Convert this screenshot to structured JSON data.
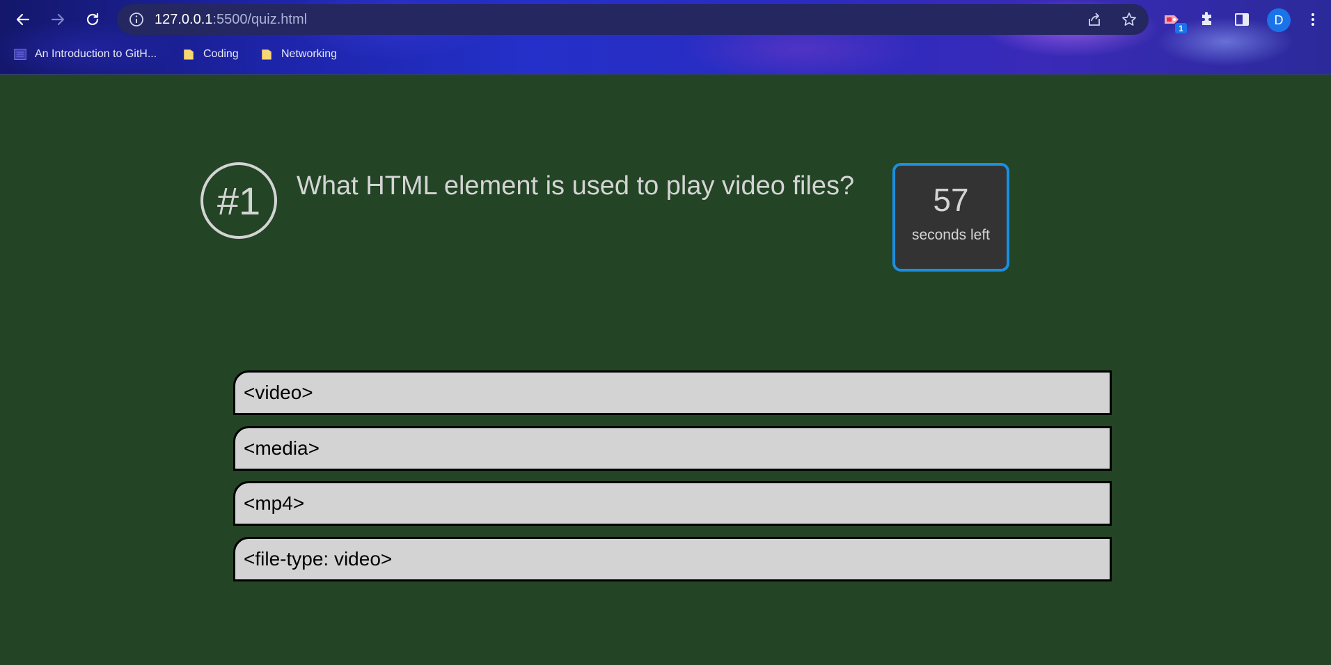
{
  "browser": {
    "url_host": "127.0.0.1",
    "url_rest": ":5500/quiz.html",
    "avatar_letter": "D",
    "extension_badge": "1",
    "bookmarks": [
      {
        "label": "An Introduction to GitH...",
        "icon": "github-page-icon"
      },
      {
        "label": "Coding",
        "icon": "folder-icon"
      },
      {
        "label": "Networking",
        "icon": "folder-icon"
      }
    ]
  },
  "quiz": {
    "number": "#1",
    "question": "What HTML element is used to play video files?",
    "timer_value": "57",
    "timer_label": "seconds left",
    "answers": [
      "<video>",
      "<media>",
      "<mp4>",
      "<file-type: video>"
    ]
  },
  "colors": {
    "page_background": "#234425",
    "answer_background": "#d3d3d3",
    "timer_background": "#333333",
    "timer_border": "#1a8fe0",
    "text_light": "#d4d4d4"
  }
}
